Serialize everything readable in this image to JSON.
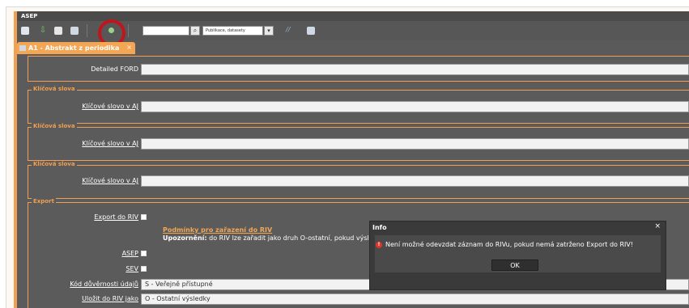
{
  "window": {
    "title": "ASEP"
  },
  "toolbar": {
    "search_value": "",
    "publication_select": "Publikace, datasety",
    "extra_glyph": "//"
  },
  "tab": {
    "label": "A1 - Abstrakt z periodika",
    "close": "×"
  },
  "form": {
    "detailed_ford": {
      "label": "Detailed FORD",
      "value": ""
    },
    "keywords": [
      {
        "legend": "Klíčová slova",
        "label": "Klíčové slovo v AJ",
        "value": ""
      },
      {
        "legend": "Klíčová slova",
        "label": "Klíčové slovo v AJ",
        "value": ""
      },
      {
        "legend": "Klíčová slova",
        "label": "Klíčové slovo v AJ",
        "value": ""
      }
    ],
    "export": {
      "legend": "Export",
      "export_label": "Export do RIV",
      "conditions_link": "Podmínky pro zařazení do RIV",
      "warning_prefix": "Upozornění:",
      "warning_text": " do RIV lze zařadit  jako druh O-ostatní, pokud  výsle",
      "asep_label": "ASEP",
      "sev_label": "SEV",
      "confidentiality_label": "Kód důvěrnosti údajů",
      "confidentiality_value": "S - Veřejně přístupné",
      "save_as_label": "Uložit do RIV jako",
      "save_as_value": "O - Ostatní výsledky"
    }
  },
  "dialog": {
    "title": "Info",
    "close": "×",
    "message": "Není možné odevzdat záznam do RIVu, pokud nemá zatrženo Export do RIV!",
    "ok_label": "OK"
  }
}
